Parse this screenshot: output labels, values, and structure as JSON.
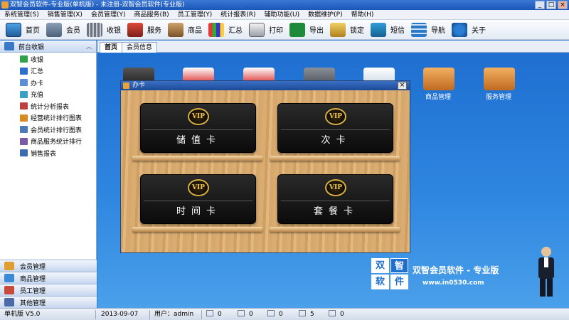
{
  "window": {
    "title": "双智会员软件-专业版(单机版) - 未注册-双智会员软件(专业版)",
    "buttons": [
      "_",
      "□",
      "×"
    ]
  },
  "menu": [
    "系统管理(S)",
    "销售管理(X)",
    "会员管理(Y)",
    "商品服务(B)",
    "员工管理(Y)",
    "统计报表(R)",
    "辅助功能(U)",
    "数据维护(P)",
    "帮助(H)"
  ],
  "toolbar": [
    {
      "label": "首页",
      "icon": "home-icon"
    },
    {
      "label": "会员",
      "icon": "member-icon"
    },
    {
      "label": "收银",
      "icon": "cash-register-icon"
    },
    {
      "label": "服务",
      "icon": "service-icon"
    },
    {
      "label": "商品",
      "icon": "goods-icon"
    },
    {
      "label": "汇总",
      "icon": "summary-chart-icon"
    },
    {
      "label": "打印",
      "icon": "print-icon"
    },
    {
      "label": "导出",
      "icon": "excel-export-icon"
    },
    {
      "label": "锁定",
      "icon": "lock-icon"
    },
    {
      "label": "短信",
      "icon": "sms-icon"
    },
    {
      "label": "导航",
      "icon": "navigation-icon"
    },
    {
      "label": "关于",
      "icon": "about-icon"
    }
  ],
  "sidebar": {
    "header": "前台收银",
    "items": [
      {
        "label": "收银"
      },
      {
        "label": "汇总"
      },
      {
        "label": "办卡"
      },
      {
        "label": "充值"
      },
      {
        "label": "统计分析报表"
      },
      {
        "label": "经营统计排行图表"
      },
      {
        "label": "会员统计排行图表"
      },
      {
        "label": "商品服务统计排行"
      },
      {
        "label": "销售报表"
      }
    ],
    "sections": [
      "会员管理",
      "商品管理",
      "员工管理",
      "其他管理"
    ]
  },
  "tabs": [
    "首页",
    "会员信息"
  ],
  "desktop": {
    "icons": [
      "商品管理",
      "服务管理"
    ]
  },
  "dialog": {
    "title": "办卡",
    "close": "×",
    "cards": [
      {
        "badge": "VIP",
        "name": "储值卡"
      },
      {
        "badge": "VIP",
        "name": "次卡"
      },
      {
        "badge": "VIP",
        "name": "时间卡"
      },
      {
        "badge": "VIP",
        "name": "套餐卡"
      }
    ]
  },
  "brand": {
    "chars": [
      "双",
      "智",
      "软",
      "件"
    ],
    "title": "双智会员软件 - 专业版",
    "url": "www.in0530.com"
  },
  "status": {
    "edition": "单机版 V5.0",
    "date": "2013-09-07",
    "user": "用户：admin",
    "counts": [
      "0",
      "0",
      "0",
      "5",
      "0"
    ]
  }
}
